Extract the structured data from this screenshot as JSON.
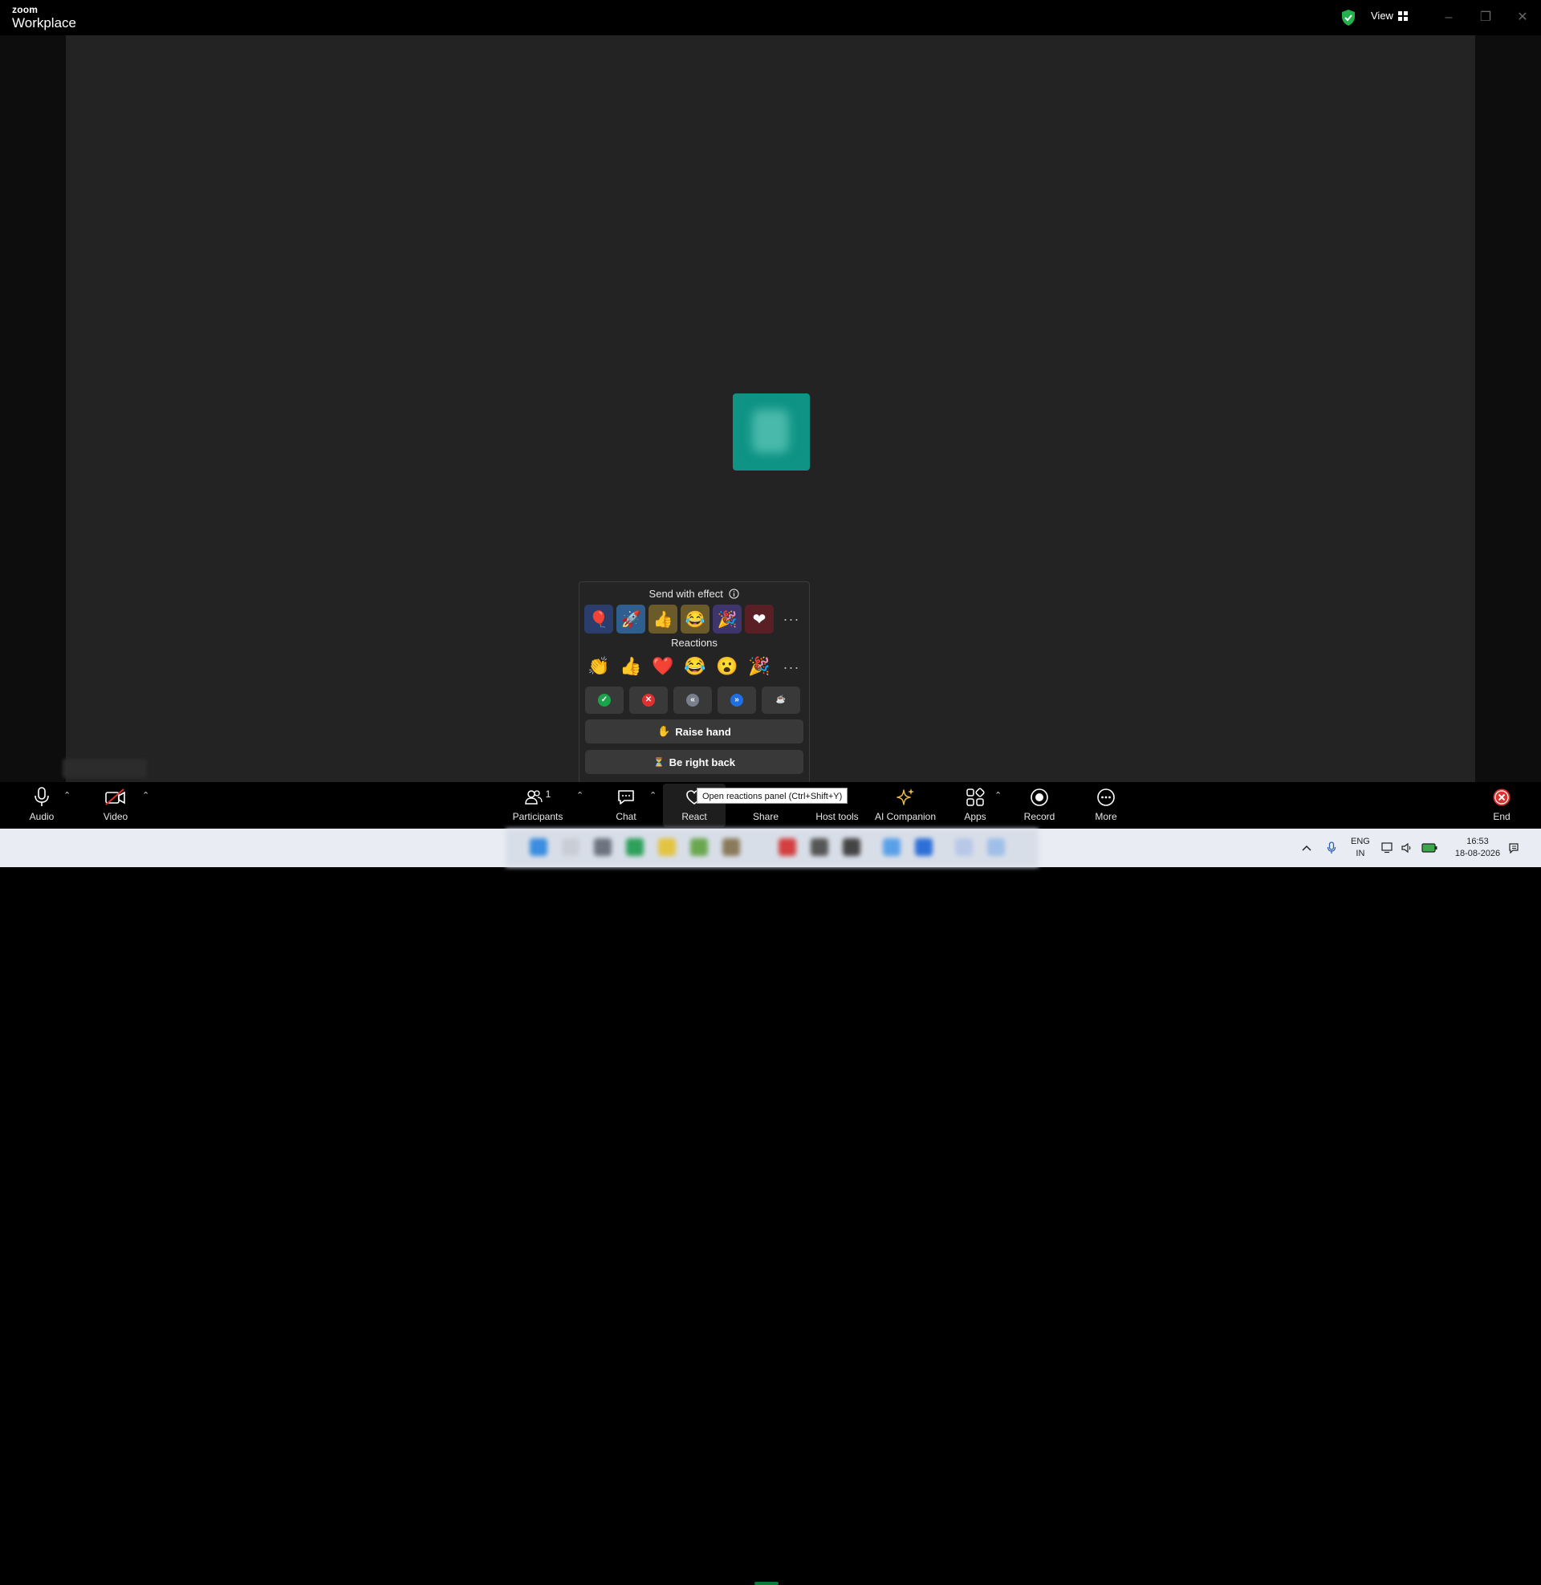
{
  "app": {
    "brand_top": "zoom",
    "brand_bottom": "Workplace",
    "view_label": "View"
  },
  "reactions_panel": {
    "effects_heading": "Send with effect",
    "effects": [
      {
        "icon": "balloon-icon",
        "glyph": "🎈",
        "bg": "#2a3d6b"
      },
      {
        "icon": "rocket-icon",
        "glyph": "🚀",
        "bg": "#2f5f8f"
      },
      {
        "icon": "thumbs-up-effect-icon",
        "glyph": "👍",
        "bg": "#6b5a2a"
      },
      {
        "icon": "laugh-effect-icon",
        "glyph": "😂",
        "bg": "#6b5a2a"
      },
      {
        "icon": "party-effect-icon",
        "glyph": "🎉",
        "bg": "#3d356b"
      },
      {
        "icon": "heart-effect-icon",
        "glyph": "❤",
        "bg": "#5a1f25"
      }
    ],
    "reactions_heading": "Reactions",
    "reactions": [
      {
        "icon": "clap-icon",
        "glyph": "👏"
      },
      {
        "icon": "thumbs-up-icon",
        "glyph": "👍"
      },
      {
        "icon": "heart-icon",
        "glyph": "❤️"
      },
      {
        "icon": "tears-of-joy-icon",
        "glyph": "😂"
      },
      {
        "icon": "open-mouth-icon",
        "glyph": "😮"
      },
      {
        "icon": "tada-icon",
        "glyph": "🎉"
      }
    ],
    "status": [
      {
        "name": "yes",
        "glyph": "✓",
        "color": "#1aa34a"
      },
      {
        "name": "no",
        "glyph": "✕",
        "color": "#e02f2f"
      },
      {
        "name": "slow-down",
        "glyph": "«",
        "color": "#7a7f8c"
      },
      {
        "name": "speed-up",
        "glyph": "»",
        "color": "#1f6fe0"
      },
      {
        "name": "coffee",
        "glyph": "☕",
        "color": "#393939"
      }
    ],
    "raise_hand": {
      "glyph": "✋",
      "label": "Raise hand"
    },
    "be_right_back": {
      "glyph": "⏳",
      "label": "Be right back"
    }
  },
  "toolbar": {
    "audio": "Audio",
    "video": "Video",
    "participants": "Participants",
    "participants_count": "1",
    "chat": "Chat",
    "react": "React",
    "share": "Share",
    "host_tools": "Host tools",
    "ai_companion": "AI Companion",
    "apps": "Apps",
    "record": "Record",
    "more": "More",
    "end": "End",
    "react_tooltip": "Open reactions panel (Ctrl+Shift+Y)"
  },
  "colors": {
    "end_red": "#e02f2f",
    "ai_gold": "#e8b84a",
    "avatar_teal": "#0e9384"
  },
  "system_tray": {
    "lang_top": "ENG",
    "lang_bottom": "IN",
    "time": "16:53",
    "date": "18-08-2026"
  }
}
